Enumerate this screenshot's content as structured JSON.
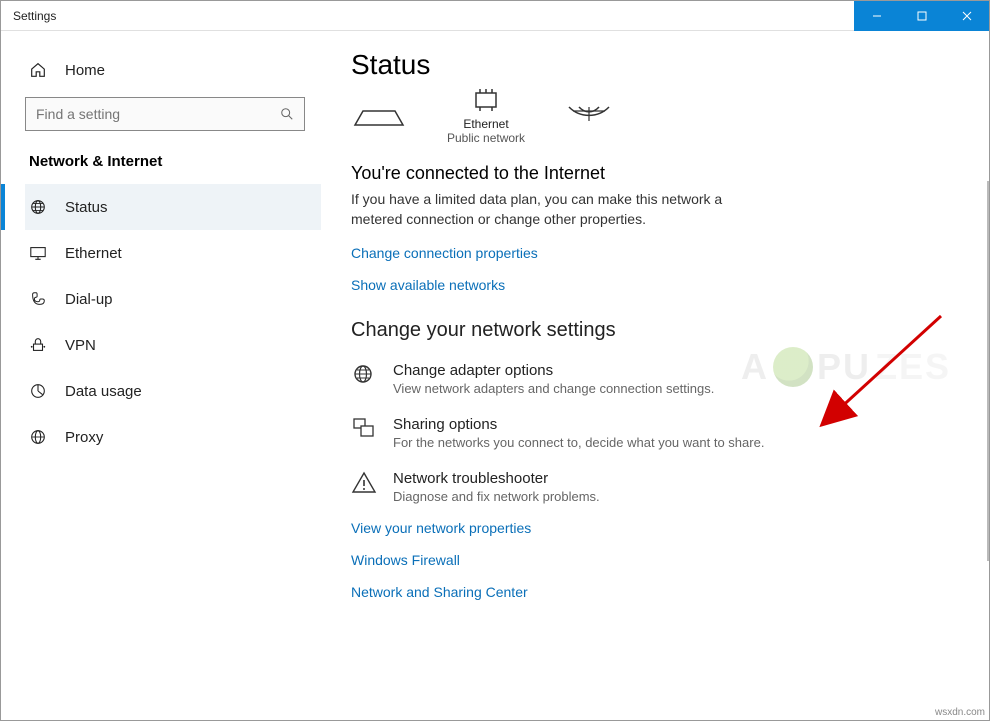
{
  "window": {
    "title": "Settings"
  },
  "sidebar": {
    "home": "Home",
    "search_placeholder": "Find a setting",
    "category": "Network & Internet",
    "items": [
      {
        "label": "Status",
        "active": true
      },
      {
        "label": "Ethernet",
        "active": false
      },
      {
        "label": "Dial-up",
        "active": false
      },
      {
        "label": "VPN",
        "active": false
      },
      {
        "label": "Data usage",
        "active": false
      },
      {
        "label": "Proxy",
        "active": false
      }
    ]
  },
  "content": {
    "title": "Status",
    "diagram": {
      "center_label": "Ethernet",
      "center_sub": "Public network"
    },
    "connected_heading": "You're connected to the Internet",
    "connected_para": "If you have a limited data plan, you can make this network a metered connection or change other properties.",
    "link_change_conn": "Change connection properties",
    "link_show_avail": "Show available networks",
    "net_settings_heading": "Change your network settings",
    "options": [
      {
        "title": "Change adapter options",
        "desc": "View network adapters and change connection settings."
      },
      {
        "title": "Sharing options",
        "desc": "For the networks you connect to, decide what you want to share."
      },
      {
        "title": "Network troubleshooter",
        "desc": "Diagnose and fix network problems."
      }
    ],
    "link_view_props": "View your network properties",
    "link_firewall": "Windows Firewall",
    "link_sharing_center": "Network and Sharing Center"
  },
  "footer": {
    "source": "wsxdn.com"
  }
}
